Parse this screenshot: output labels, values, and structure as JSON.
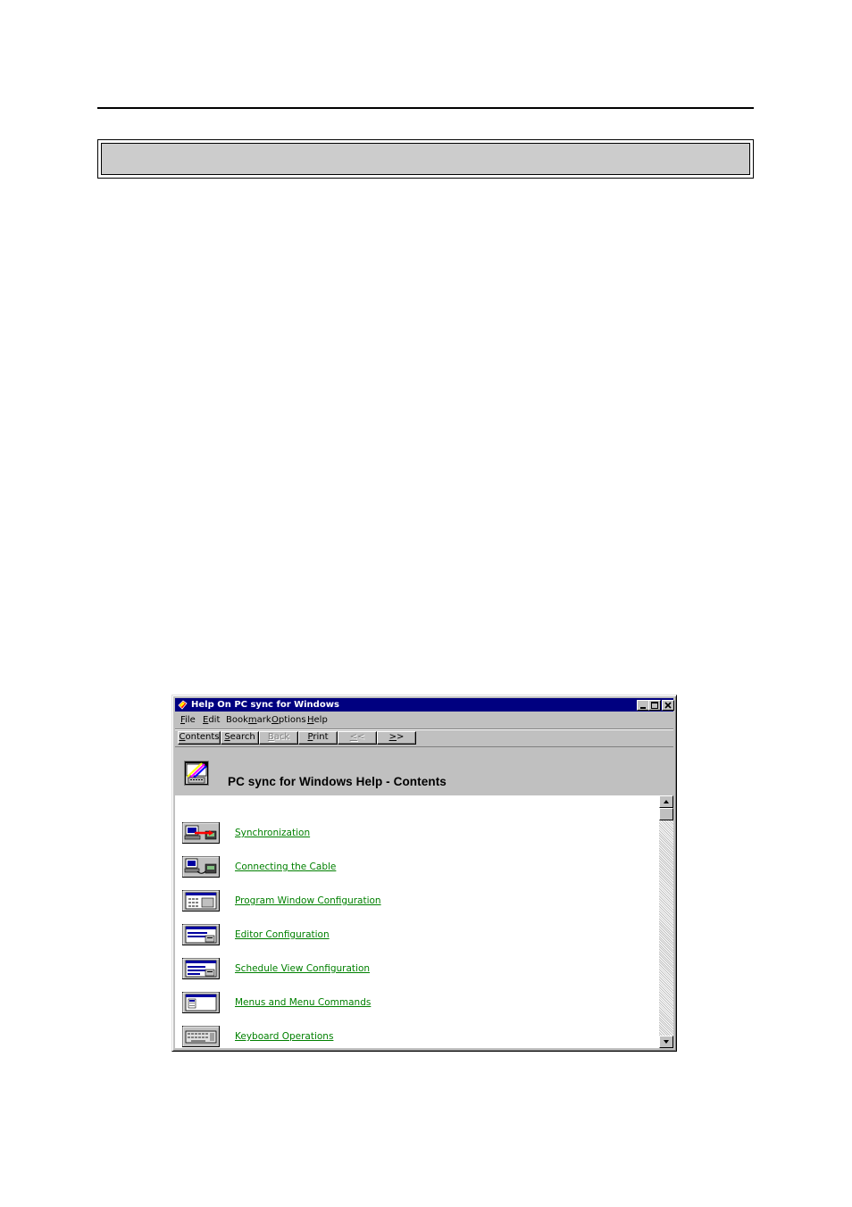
{
  "window": {
    "title": "Help On PC sync for Windows"
  },
  "menu": [
    {
      "label": "File",
      "accel": "F",
      "rest": "ile"
    },
    {
      "label": "Edit",
      "accel": "E",
      "rest": "dit"
    },
    {
      "label": "Bookmark",
      "pre": "Book",
      "accel": "m",
      "rest": "ark"
    },
    {
      "label": "Options",
      "accel": "O",
      "rest": "ptions"
    },
    {
      "label": "Help",
      "accel": "H",
      "rest": "elp"
    }
  ],
  "toolbar": {
    "contents": {
      "accel": "C",
      "rest": "ontents"
    },
    "search": {
      "accel": "S",
      "rest": "earch"
    },
    "back": {
      "accel": "B",
      "rest": "ack"
    },
    "print": {
      "accel": "P",
      "rest": "rint"
    },
    "prev": {
      "accel": "<",
      "rest": "<"
    },
    "next": {
      "accel": ">",
      "rest": ">"
    }
  },
  "contents": {
    "title": "PC sync for Windows Help - Contents"
  },
  "topics": [
    {
      "label": "Synchronization",
      "icon": "sync-icon"
    },
    {
      "label": "Connecting the Cable",
      "icon": "cable-icon"
    },
    {
      "label": "Program Window Configuration",
      "icon": "window-config-icon"
    },
    {
      "label": "Editor Configuration",
      "icon": "editor-config-icon"
    },
    {
      "label": "Schedule View Configuration",
      "icon": "schedule-config-icon"
    },
    {
      "label": "Menus and Menu Commands",
      "icon": "menu-icon"
    },
    {
      "label": "Keyboard Operations",
      "icon": "keyboard-icon"
    }
  ],
  "colors": {
    "titlebar": "#000080",
    "link": "#008000",
    "face": "#c0c0c0",
    "header_box": "#cccccc"
  }
}
